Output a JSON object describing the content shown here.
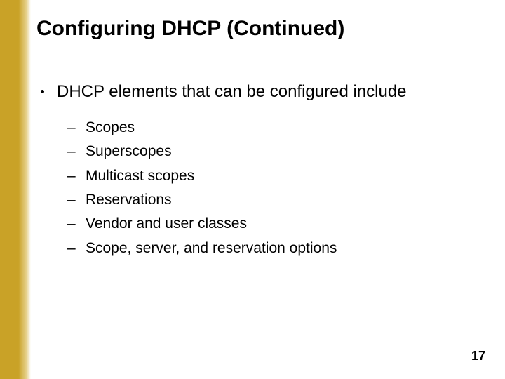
{
  "title": "Configuring DHCP (Continued)",
  "bullet": "DHCP elements that can be configured include",
  "sub_items": [
    "Scopes",
    "Superscopes",
    "Multicast scopes",
    "Reservations",
    "Vendor and user classes",
    "Scope, server, and reservation options"
  ],
  "page_number": "17"
}
